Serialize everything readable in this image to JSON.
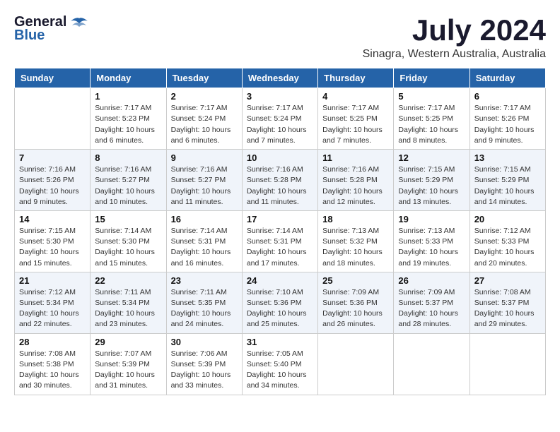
{
  "header": {
    "logo_general": "General",
    "logo_blue": "Blue",
    "month_title": "July 2024",
    "location": "Sinagra, Western Australia, Australia"
  },
  "calendar": {
    "columns": [
      "Sunday",
      "Monday",
      "Tuesday",
      "Wednesday",
      "Thursday",
      "Friday",
      "Saturday"
    ],
    "weeks": [
      [
        {
          "day": "",
          "info": ""
        },
        {
          "day": "1",
          "info": "Sunrise: 7:17 AM\nSunset: 5:23 PM\nDaylight: 10 hours\nand 6 minutes."
        },
        {
          "day": "2",
          "info": "Sunrise: 7:17 AM\nSunset: 5:24 PM\nDaylight: 10 hours\nand 6 minutes."
        },
        {
          "day": "3",
          "info": "Sunrise: 7:17 AM\nSunset: 5:24 PM\nDaylight: 10 hours\nand 7 minutes."
        },
        {
          "day": "4",
          "info": "Sunrise: 7:17 AM\nSunset: 5:25 PM\nDaylight: 10 hours\nand 7 minutes."
        },
        {
          "day": "5",
          "info": "Sunrise: 7:17 AM\nSunset: 5:25 PM\nDaylight: 10 hours\nand 8 minutes."
        },
        {
          "day": "6",
          "info": "Sunrise: 7:17 AM\nSunset: 5:26 PM\nDaylight: 10 hours\nand 9 minutes."
        }
      ],
      [
        {
          "day": "7",
          "info": "Sunrise: 7:16 AM\nSunset: 5:26 PM\nDaylight: 10 hours\nand 9 minutes."
        },
        {
          "day": "8",
          "info": "Sunrise: 7:16 AM\nSunset: 5:27 PM\nDaylight: 10 hours\nand 10 minutes."
        },
        {
          "day": "9",
          "info": "Sunrise: 7:16 AM\nSunset: 5:27 PM\nDaylight: 10 hours\nand 11 minutes."
        },
        {
          "day": "10",
          "info": "Sunrise: 7:16 AM\nSunset: 5:28 PM\nDaylight: 10 hours\nand 11 minutes."
        },
        {
          "day": "11",
          "info": "Sunrise: 7:16 AM\nSunset: 5:28 PM\nDaylight: 10 hours\nand 12 minutes."
        },
        {
          "day": "12",
          "info": "Sunrise: 7:15 AM\nSunset: 5:29 PM\nDaylight: 10 hours\nand 13 minutes."
        },
        {
          "day": "13",
          "info": "Sunrise: 7:15 AM\nSunset: 5:29 PM\nDaylight: 10 hours\nand 14 minutes."
        }
      ],
      [
        {
          "day": "14",
          "info": "Sunrise: 7:15 AM\nSunset: 5:30 PM\nDaylight: 10 hours\nand 15 minutes."
        },
        {
          "day": "15",
          "info": "Sunrise: 7:14 AM\nSunset: 5:30 PM\nDaylight: 10 hours\nand 15 minutes."
        },
        {
          "day": "16",
          "info": "Sunrise: 7:14 AM\nSunset: 5:31 PM\nDaylight: 10 hours\nand 16 minutes."
        },
        {
          "day": "17",
          "info": "Sunrise: 7:14 AM\nSunset: 5:31 PM\nDaylight: 10 hours\nand 17 minutes."
        },
        {
          "day": "18",
          "info": "Sunrise: 7:13 AM\nSunset: 5:32 PM\nDaylight: 10 hours\nand 18 minutes."
        },
        {
          "day": "19",
          "info": "Sunrise: 7:13 AM\nSunset: 5:33 PM\nDaylight: 10 hours\nand 19 minutes."
        },
        {
          "day": "20",
          "info": "Sunrise: 7:12 AM\nSunset: 5:33 PM\nDaylight: 10 hours\nand 20 minutes."
        }
      ],
      [
        {
          "day": "21",
          "info": "Sunrise: 7:12 AM\nSunset: 5:34 PM\nDaylight: 10 hours\nand 22 minutes."
        },
        {
          "day": "22",
          "info": "Sunrise: 7:11 AM\nSunset: 5:34 PM\nDaylight: 10 hours\nand 23 minutes."
        },
        {
          "day": "23",
          "info": "Sunrise: 7:11 AM\nSunset: 5:35 PM\nDaylight: 10 hours\nand 24 minutes."
        },
        {
          "day": "24",
          "info": "Sunrise: 7:10 AM\nSunset: 5:36 PM\nDaylight: 10 hours\nand 25 minutes."
        },
        {
          "day": "25",
          "info": "Sunrise: 7:09 AM\nSunset: 5:36 PM\nDaylight: 10 hours\nand 26 minutes."
        },
        {
          "day": "26",
          "info": "Sunrise: 7:09 AM\nSunset: 5:37 PM\nDaylight: 10 hours\nand 28 minutes."
        },
        {
          "day": "27",
          "info": "Sunrise: 7:08 AM\nSunset: 5:37 PM\nDaylight: 10 hours\nand 29 minutes."
        }
      ],
      [
        {
          "day": "28",
          "info": "Sunrise: 7:08 AM\nSunset: 5:38 PM\nDaylight: 10 hours\nand 30 minutes."
        },
        {
          "day": "29",
          "info": "Sunrise: 7:07 AM\nSunset: 5:39 PM\nDaylight: 10 hours\nand 31 minutes."
        },
        {
          "day": "30",
          "info": "Sunrise: 7:06 AM\nSunset: 5:39 PM\nDaylight: 10 hours\nand 33 minutes."
        },
        {
          "day": "31",
          "info": "Sunrise: 7:05 AM\nSunset: 5:40 PM\nDaylight: 10 hours\nand 34 minutes."
        },
        {
          "day": "",
          "info": ""
        },
        {
          "day": "",
          "info": ""
        },
        {
          "day": "",
          "info": ""
        }
      ]
    ]
  }
}
